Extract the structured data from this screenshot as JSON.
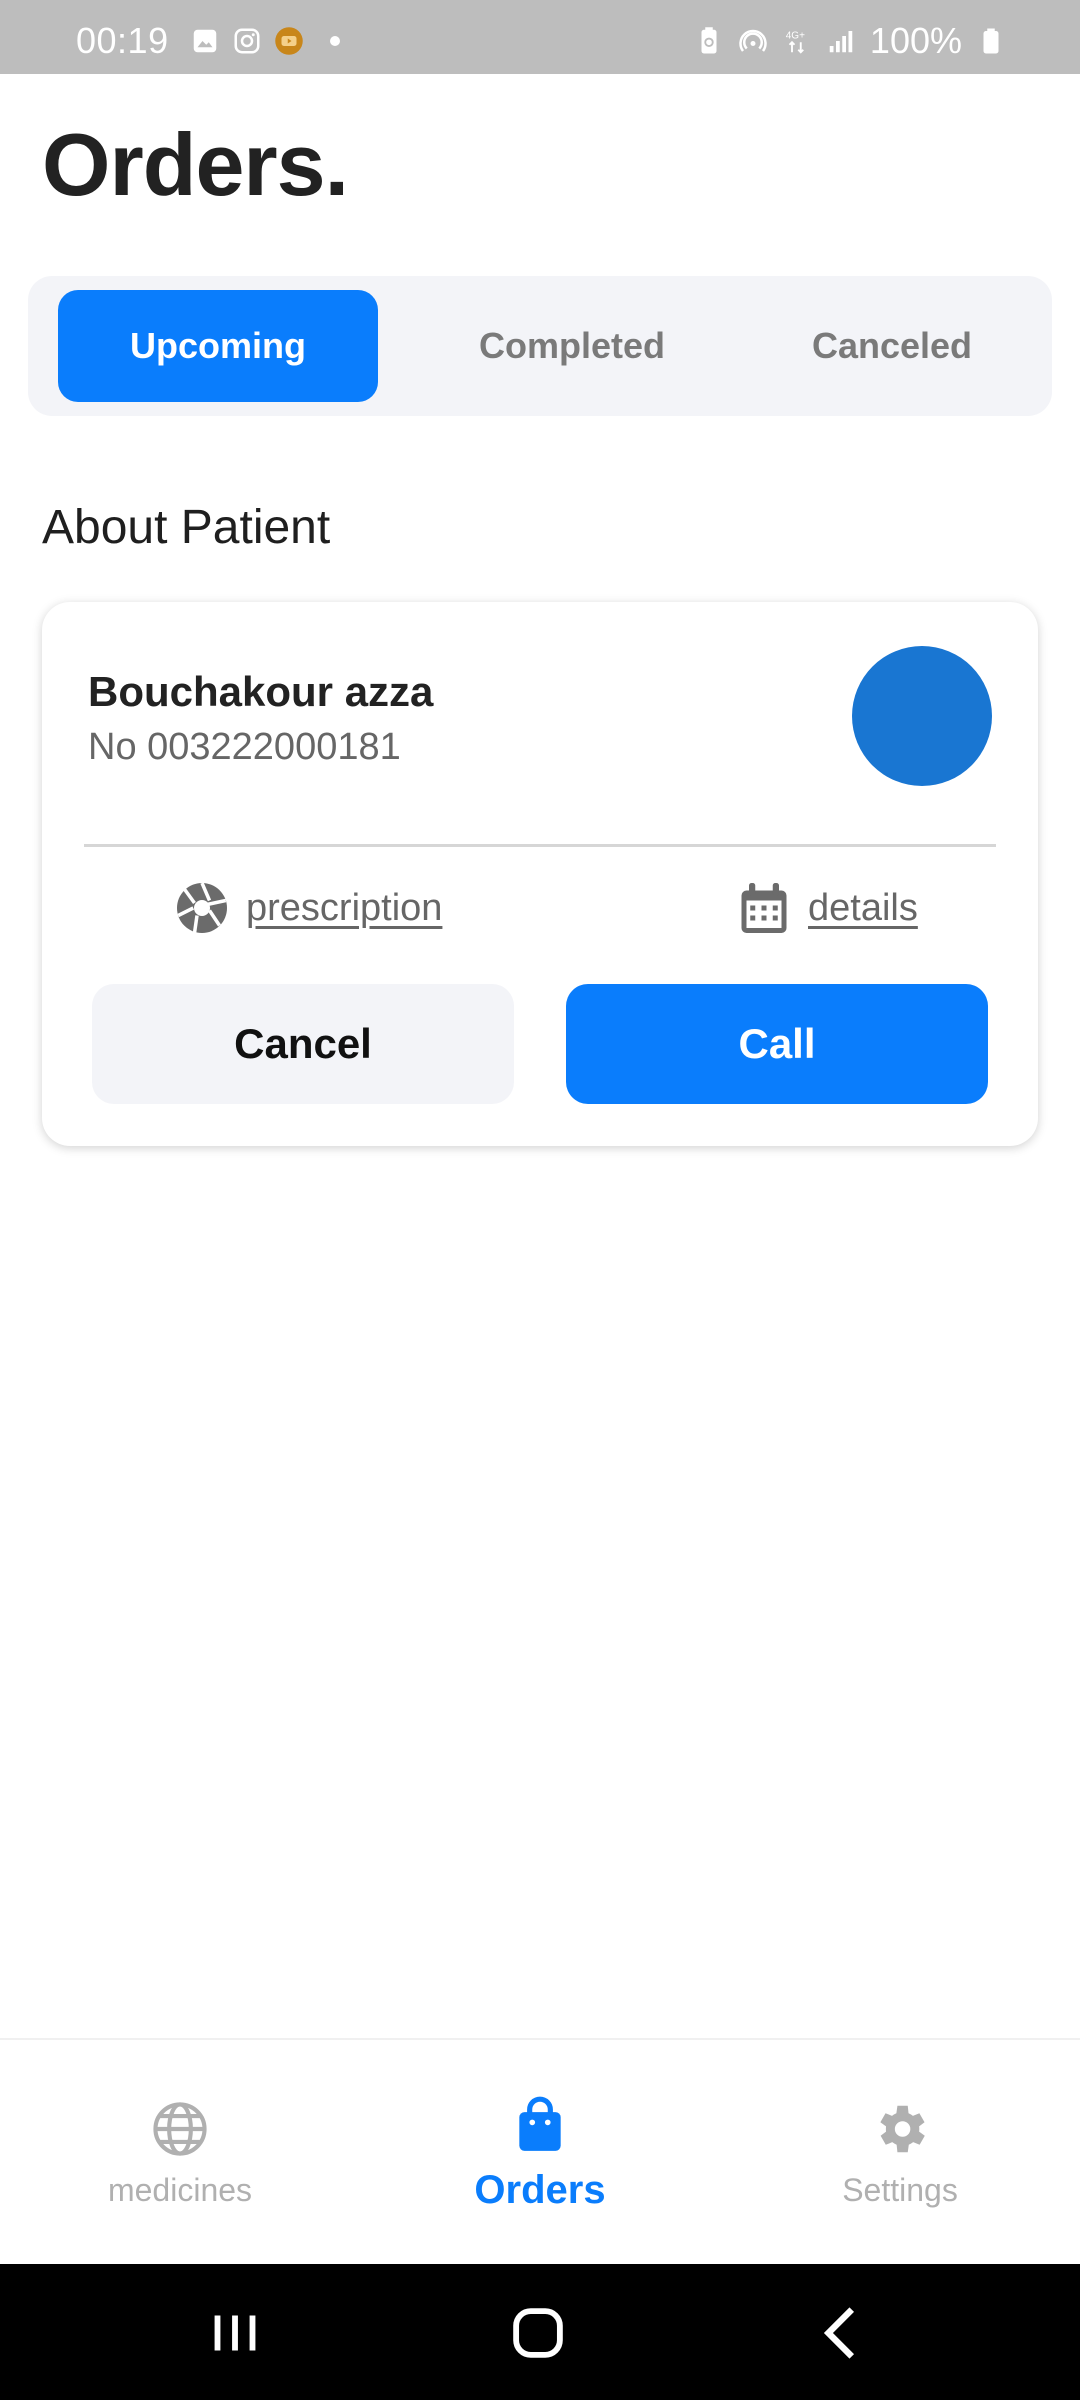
{
  "status_bar": {
    "time": "00:19",
    "battery": "100%",
    "icons_left": [
      "image-icon",
      "instagram-icon",
      "youtube-icon",
      "dot-icon"
    ],
    "icons_right": [
      "battery-saver-icon",
      "hotspot-icon",
      "4g-plus-icon",
      "signal-icon",
      "battery-icon"
    ]
  },
  "page": {
    "title": "Orders."
  },
  "tabs": [
    {
      "label": "Upcoming",
      "active": true
    },
    {
      "label": "Completed",
      "active": false
    },
    {
      "label": "Canceled",
      "active": false
    }
  ],
  "section": {
    "title": "About Patient"
  },
  "patient_card": {
    "name": "Bouchakour azza",
    "number": "No 003222000181",
    "avatar_color": "#1976d2",
    "prescription_link": "prescription",
    "details_link": "details",
    "cancel_label": "Cancel",
    "call_label": "Call"
  },
  "bottom_nav": {
    "items": [
      {
        "label": "medicines",
        "icon": "globe-icon",
        "active": false
      },
      {
        "label": "Orders",
        "icon": "shopping-bag-icon",
        "active": true
      },
      {
        "label": "Settings",
        "icon": "gear-icon",
        "active": false
      }
    ]
  },
  "colors": {
    "accent": "#0a7dfc",
    "status_bar": "#bdbdbd",
    "tab_background": "#f3f4f8"
  }
}
